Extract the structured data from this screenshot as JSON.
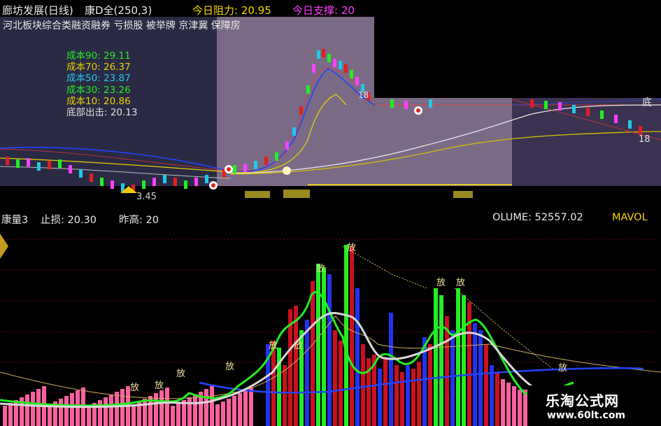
{
  "header": {
    "stock": "廊坊发展(日线)",
    "indicator": "康D全(250,3)",
    "resistance": "今日阻力: 20.95",
    "support": "今日支撑: 20"
  },
  "sectors": "河北板块综合类融资融券 亏损股 被举牌 京津冀 保障房",
  "cost_lines": [
    {
      "text": "成本90: 29.11",
      "color": "#22ee22"
    },
    {
      "text": "成本70: 26.37",
      "color": "#e8d000"
    },
    {
      "text": "成本50: 23.87",
      "color": "#22c8e8"
    },
    {
      "text": "成本30: 23.26",
      "color": "#22ee22"
    },
    {
      "text": "成本10: 20.86",
      "color": "#e8d000"
    },
    {
      "text": "底部出击: 20.13",
      "color": "#e0e0e0"
    }
  ],
  "upper_labels": {
    "low_price": "3.45",
    "tag_right": "18",
    "tag_left": "18",
    "glyph_bottom": "底"
  },
  "lower_header": {
    "indicator": "康量3",
    "stop": "止损: 20.30",
    "prev_high": "昨高: 20",
    "volume": "OLUME: 52557.02",
    "mavol": "MAVOL"
  },
  "signal_label": "放",
  "watermark": {
    "name": "乐淘公式网",
    "url": "www.60lt.com"
  }
}
